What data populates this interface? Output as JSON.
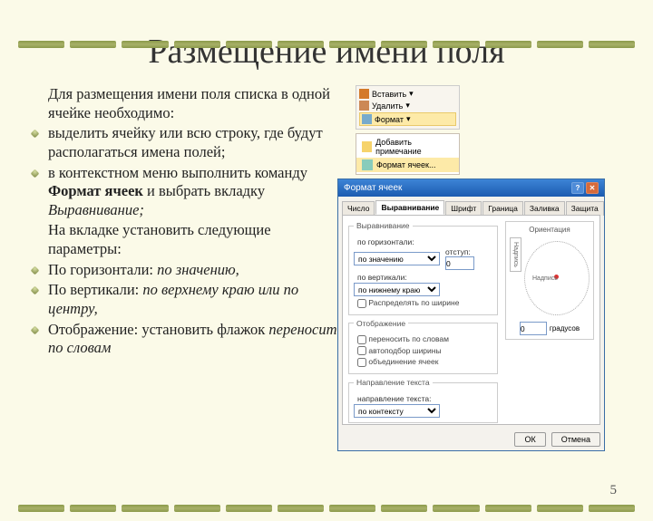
{
  "title": "Размещение имени поля",
  "intro": "Для размещения имени поля списка в одной ячейке необходимо:",
  "bullets": [
    "выделить ячейку или всю строку, где будут располагаться имена полей;",
    {
      "pre": "в контекстном меню выполнить команду ",
      "b": "Формат ячеек",
      "post": " и выбрать вкладку ",
      "i": "Выравнивание;"
    }
  ],
  "intro2": "На вкладке установить следующие параметры:",
  "bullets2": [
    {
      "pre": "По горизонтали: ",
      "i": "по значению,"
    },
    {
      "pre": "По вертикали: ",
      "i": "по верхнему краю или по центру,"
    },
    {
      "pre": "Отображение: установить флажок ",
      "i": "переносить по словам"
    }
  ],
  "ribbon": {
    "insert": "Вставить",
    "delete": "Удалить",
    "format": "Формат"
  },
  "context_menu": [
    "Добавить примечание",
    "Формат ячеек..."
  ],
  "dialog": {
    "title": "Формат ячеек",
    "tabs": [
      "Число",
      "Выравнивание",
      "Шрифт",
      "Граница",
      "Заливка",
      "Защита"
    ],
    "active_tab": 1,
    "group_align": "Выравнивание",
    "lbl_horiz": "по горизонтали:",
    "val_horiz": "по значению",
    "lbl_indent": "отступ:",
    "val_indent": "0",
    "lbl_vert": "по вертикали:",
    "val_vert": "по нижнему краю",
    "chk_distrib": "Распределять по ширине",
    "group_display": "Отображение",
    "chk_wrap": "переносить по словам",
    "chk_shrink": "автоподбор ширины",
    "chk_merge": "объединение ячеек",
    "group_dir": "Направление текста",
    "lbl_dir": "направление текста:",
    "val_dir": "по контексту",
    "group_orient": "Ориентация",
    "orient_text": "Надпись",
    "deg_label": "градусов",
    "deg_value": "0",
    "ok": "ОК",
    "cancel": "Отмена"
  },
  "page_number": "5"
}
